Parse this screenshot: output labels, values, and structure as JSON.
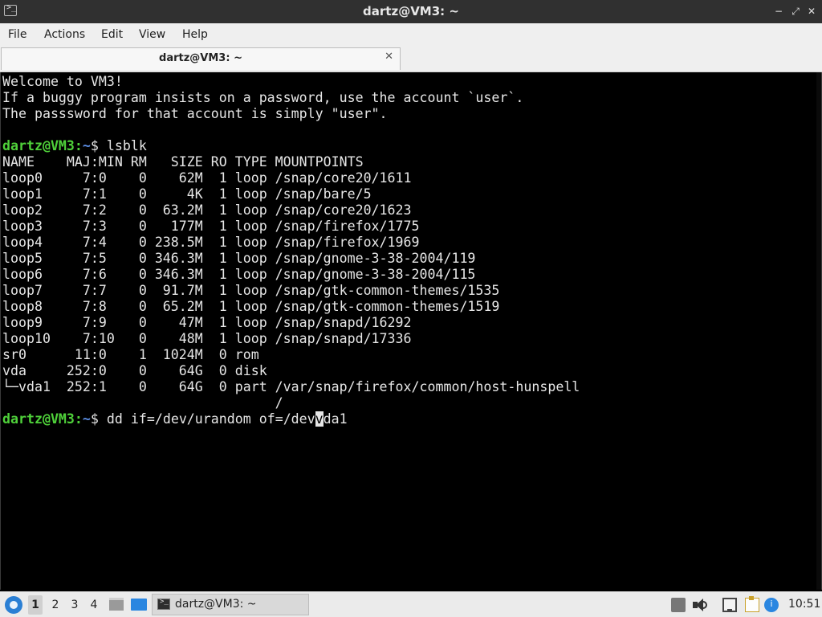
{
  "window": {
    "title": "dartz@VM3: ~",
    "app_icon_glyph": ">_",
    "buttons": {
      "minimize": "−",
      "restore": "⤢",
      "close": "✕"
    }
  },
  "menu": {
    "items": [
      "File",
      "Actions",
      "Edit",
      "View",
      "Help"
    ]
  },
  "tab": {
    "label": "dartz@VM3: ~",
    "close_glyph": "✕"
  },
  "terminal": {
    "colors": {
      "user": "#4fd13a",
      "path": "#5c8fe6",
      "text": "#e6e6e6",
      "background": "#000000"
    },
    "prompt": {
      "user_host": "dartz@VM3",
      "colon": ":",
      "path": "~",
      "symbol": "$ "
    },
    "welcome": [
      "Welcome to VM3!",
      "If a buggy program insists on a password, use the account `user`.",
      "The passsword for that account is simply \"user\".",
      ""
    ],
    "command1": "lsblk",
    "lsblk_output": [
      "NAME    MAJ:MIN RM   SIZE RO TYPE MOUNTPOINTS",
      "loop0     7:0    0    62M  1 loop /snap/core20/1611",
      "loop1     7:1    0     4K  1 loop /snap/bare/5",
      "loop2     7:2    0  63.2M  1 loop /snap/core20/1623",
      "loop3     7:3    0   177M  1 loop /snap/firefox/1775",
      "loop4     7:4    0 238.5M  1 loop /snap/firefox/1969",
      "loop5     7:5    0 346.3M  1 loop /snap/gnome-3-38-2004/119",
      "loop6     7:6    0 346.3M  1 loop /snap/gnome-3-38-2004/115",
      "loop7     7:7    0  91.7M  1 loop /snap/gtk-common-themes/1535",
      "loop8     7:8    0  65.2M  1 loop /snap/gtk-common-themes/1519",
      "loop9     7:9    0    47M  1 loop /snap/snapd/16292",
      "loop10    7:10   0    48M  1 loop /snap/snapd/17336",
      "sr0      11:0    1  1024M  0 rom",
      "vda     252:0    0    64G  0 disk",
      "└─vda1  252:1    0    64G  0 part /var/snap/firefox/common/host-hunspell",
      "                                  /"
    ],
    "command2_before_cursor": "dd if=/dev/urandom of=/dev",
    "command2_cursor_char": "v",
    "command2_after_cursor": "da1"
  },
  "taskbar": {
    "start_icon": "lxqt-start-icon",
    "desktops": [
      "1",
      "2",
      "3",
      "4"
    ],
    "active_desktop": "1",
    "task_label": "dartz@VM3: ~",
    "clock": "10:51"
  }
}
